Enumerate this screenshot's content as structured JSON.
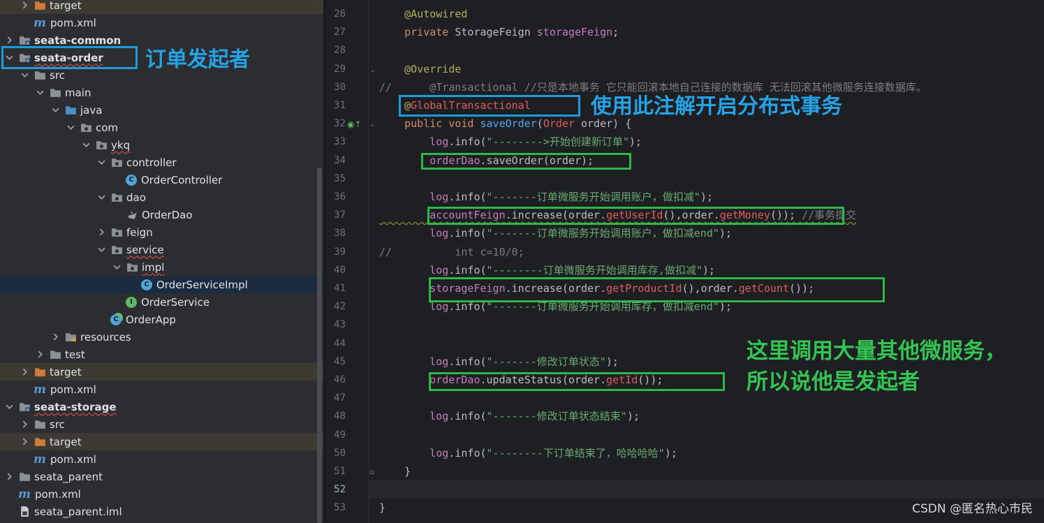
{
  "tree": {
    "rows": [
      {
        "label": "target",
        "icon": "folder-orange-icon",
        "arrow": "right",
        "indent": 1,
        "excluded": true
      },
      {
        "label": "pom.xml",
        "icon": "maven-icon",
        "arrow": "",
        "indent": 1
      },
      {
        "label": "seata-common",
        "icon": "module-folder-icon",
        "arrow": "right",
        "indent": 0,
        "module": true
      },
      {
        "label": "seata-order",
        "icon": "module-folder-icon",
        "arrow": "down",
        "indent": 0,
        "module": true
      },
      {
        "label": "src",
        "icon": "folder-icon",
        "arrow": "down",
        "indent": 1
      },
      {
        "label": "main",
        "icon": "folder-icon",
        "arrow": "down",
        "indent": 2
      },
      {
        "label": "java",
        "icon": "source-folder-icon",
        "arrow": "down",
        "indent": 3
      },
      {
        "label": "com",
        "icon": "package-icon",
        "arrow": "down",
        "indent": 4
      },
      {
        "label": "ykq",
        "icon": "package-icon",
        "arrow": "down",
        "indent": 5
      },
      {
        "label": "controller",
        "icon": "package-icon",
        "arrow": "down",
        "indent": 6
      },
      {
        "label": "OrderController",
        "icon": "class-icon",
        "arrow": "",
        "indent": 7
      },
      {
        "label": "dao",
        "icon": "package-icon",
        "arrow": "down",
        "indent": 6
      },
      {
        "label": "OrderDao",
        "icon": "mybatis-icon",
        "arrow": "",
        "indent": 7
      },
      {
        "label": "feign",
        "icon": "package-icon",
        "arrow": "right",
        "indent": 6
      },
      {
        "label": "service",
        "icon": "package-icon",
        "arrow": "down",
        "indent": 6
      },
      {
        "label": "impl",
        "icon": "package-icon",
        "arrow": "down",
        "indent": 7
      },
      {
        "label": "OrderServiceImpl",
        "icon": "class-icon",
        "arrow": "",
        "indent": 8,
        "selected": true
      },
      {
        "label": "OrderService",
        "icon": "interface-icon",
        "arrow": "",
        "indent": 7
      },
      {
        "label": "OrderApp",
        "icon": "spring-class-icon",
        "arrow": "",
        "indent": 6
      },
      {
        "label": "resources",
        "icon": "resources-folder-icon",
        "arrow": "right",
        "indent": 3
      },
      {
        "label": "test",
        "icon": "folder-icon",
        "arrow": "right",
        "indent": 2
      },
      {
        "label": "target",
        "icon": "folder-orange-icon",
        "arrow": "right",
        "indent": 1,
        "excluded": true
      },
      {
        "label": "pom.xml",
        "icon": "maven-icon",
        "arrow": "",
        "indent": 1
      },
      {
        "label": "seata-storage",
        "icon": "module-folder-icon",
        "arrow": "down",
        "indent": 0,
        "module": true
      },
      {
        "label": "src",
        "icon": "folder-icon",
        "arrow": "right",
        "indent": 1
      },
      {
        "label": "target",
        "icon": "folder-orange-icon",
        "arrow": "right",
        "indent": 1,
        "excluded": true
      },
      {
        "label": "pom.xml",
        "icon": "maven-icon",
        "arrow": "",
        "indent": 1
      },
      {
        "label": "seata_parent",
        "icon": "folder-icon",
        "arrow": "right",
        "indent": 0
      },
      {
        "label": "pom.xml",
        "icon": "maven-icon",
        "arrow": "",
        "indent": 0
      },
      {
        "label": "seata_parent.iml",
        "icon": "iml-file-icon",
        "arrow": "",
        "indent": 0
      }
    ]
  },
  "editor": {
    "current_line": "52",
    "lines": [
      {
        "n": "26",
        "text": "    @Autowired"
      },
      {
        "n": "27",
        "text": "    private StorageFeign storageFeign;"
      },
      {
        "n": "28",
        "text": ""
      },
      {
        "n": "29",
        "text": "    @Override"
      },
      {
        "n": "30",
        "text": "//      @Transactional //只是本地事务 它只能回滚本地自己连接的数据库 无法回滚其他微服务连接数据库。"
      },
      {
        "n": "31",
        "text": "    @GlobalTransactional"
      },
      {
        "n": "32",
        "text": "    public void saveOrder(Order order) {"
      },
      {
        "n": "33",
        "text": "        log.info(\"-------->开始创建新订单\");"
      },
      {
        "n": "34",
        "text": "        orderDao.saveOrder(order);"
      },
      {
        "n": "35",
        "text": ""
      },
      {
        "n": "36",
        "text": "        log.info(\"-------订单微服务开始调用账户，做扣减\");"
      },
      {
        "n": "37",
        "text": "        accountFeign.increase(order.getUserId(),order.getMoney()); //事务提交"
      },
      {
        "n": "38",
        "text": "        log.info(\"-------订单微服务开始调用账户，做扣减end\");"
      },
      {
        "n": "39",
        "text": "//          int c=10/0;"
      },
      {
        "n": "40",
        "text": "        log.info(\"--------订单微服务开始调用库存,做扣减\");"
      },
      {
        "n": "41",
        "text": "        storageFeign.increase(order.getProductId(),order.getCount());"
      },
      {
        "n": "42",
        "text": "        log.info(\"-------订单微服务开始调用库存，做扣减end\");"
      },
      {
        "n": "43",
        "text": ""
      },
      {
        "n": "44",
        "text": ""
      },
      {
        "n": "45",
        "text": "        log.info(\"-------修改订单状态\");"
      },
      {
        "n": "46",
        "text": "        orderDao.updateStatus(order.getId());"
      },
      {
        "n": "47",
        "text": ""
      },
      {
        "n": "48",
        "text": "        log.info(\"-------修改订单状态结束\");"
      },
      {
        "n": "49",
        "text": ""
      },
      {
        "n": "50",
        "text": "        log.info(\"--------下订单结束了，哈哈哈哈\");"
      },
      {
        "n": "51",
        "text": "    }"
      },
      {
        "n": "52",
        "text": ""
      },
      {
        "n": "53",
        "text": "}"
      }
    ]
  },
  "annotations": {
    "order_initiator": "订单发起者",
    "global_tx_note": "使用此注解开启分布式事务",
    "callout_line1": "这里调用大量其他微服务，",
    "callout_line2": "所以说他是发起者"
  },
  "watermark": "CSDN @匿名热心市民",
  "colors": {
    "annotation_blue": "#1e9bdc",
    "annotation_green": "#2fb84a",
    "excluded_folder_bg": "#3d3a33",
    "selected_row_bg": "#1c2b3f"
  }
}
